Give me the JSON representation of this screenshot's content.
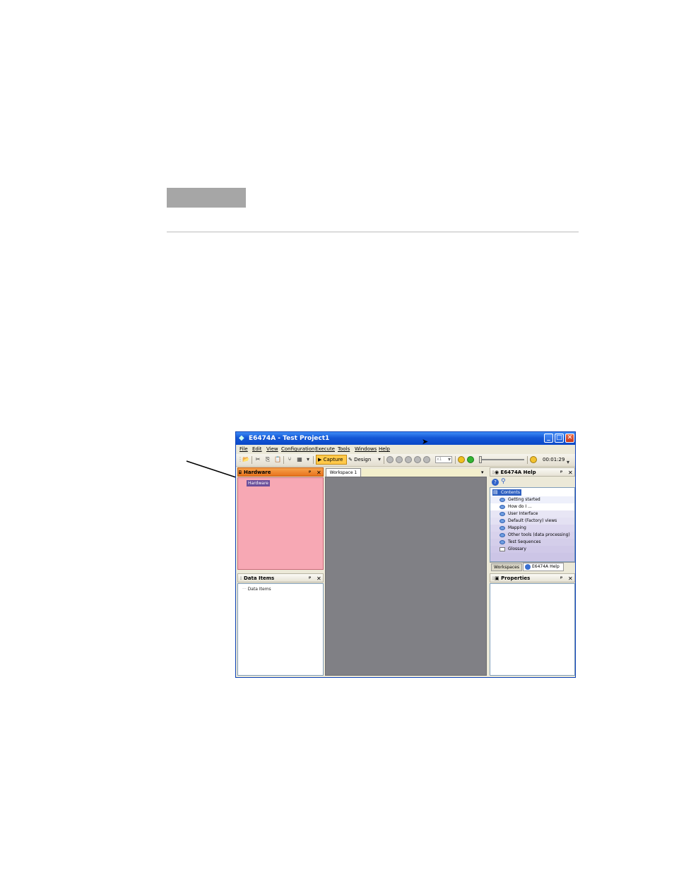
{
  "window": {
    "title": "E6474A - Test Project1",
    "controls": {
      "minimize": "_",
      "maximize": "□",
      "close": "✕"
    }
  },
  "menu": [
    "File",
    "Edit",
    "View",
    "Configuration",
    "Execute",
    "Tools",
    "Windows",
    "Help"
  ],
  "toolbar": {
    "capture_label": "Capture",
    "design_label": "Design",
    "zoom_value": "x1",
    "elapsed_time": "00:01:29",
    "overflow": "▾"
  },
  "panels": {
    "hardware": {
      "title": "Hardware",
      "tree_root": "Hardware",
      "pin": "ᵖ",
      "close": "✕"
    },
    "data_items": {
      "title": "Data Items",
      "tree_root": "Data Items",
      "pin": "ᵖ",
      "close": "✕"
    },
    "workspace": {
      "tab_label": "Workspace 1",
      "dropdown": "▾"
    },
    "help": {
      "title": "E6474A Help",
      "pin": "ᵖ",
      "close": "✕",
      "root": "Contents",
      "items": [
        "Getting started",
        "How do I ...",
        "User Interface",
        "Default (Factory) views",
        "Mapping",
        "Other tools (data processing)",
        "Test Sequences",
        "Glossary"
      ],
      "tabs": [
        "Workspaces",
        "E6474A Help"
      ]
    },
    "properties": {
      "title": "Properties",
      "pin": "ᵖ",
      "close": "✕"
    }
  },
  "icons": {
    "app": "app-icon",
    "cursor": "cursor-arrow-icon",
    "annotation": "callout-arrow"
  },
  "colors": {
    "titlebar": "#1457d6",
    "hardware_header": "#e8731d",
    "hardware_body": "#f7a8b4",
    "workspace_bg": "#808085",
    "capture_active": "#ffc94a"
  }
}
